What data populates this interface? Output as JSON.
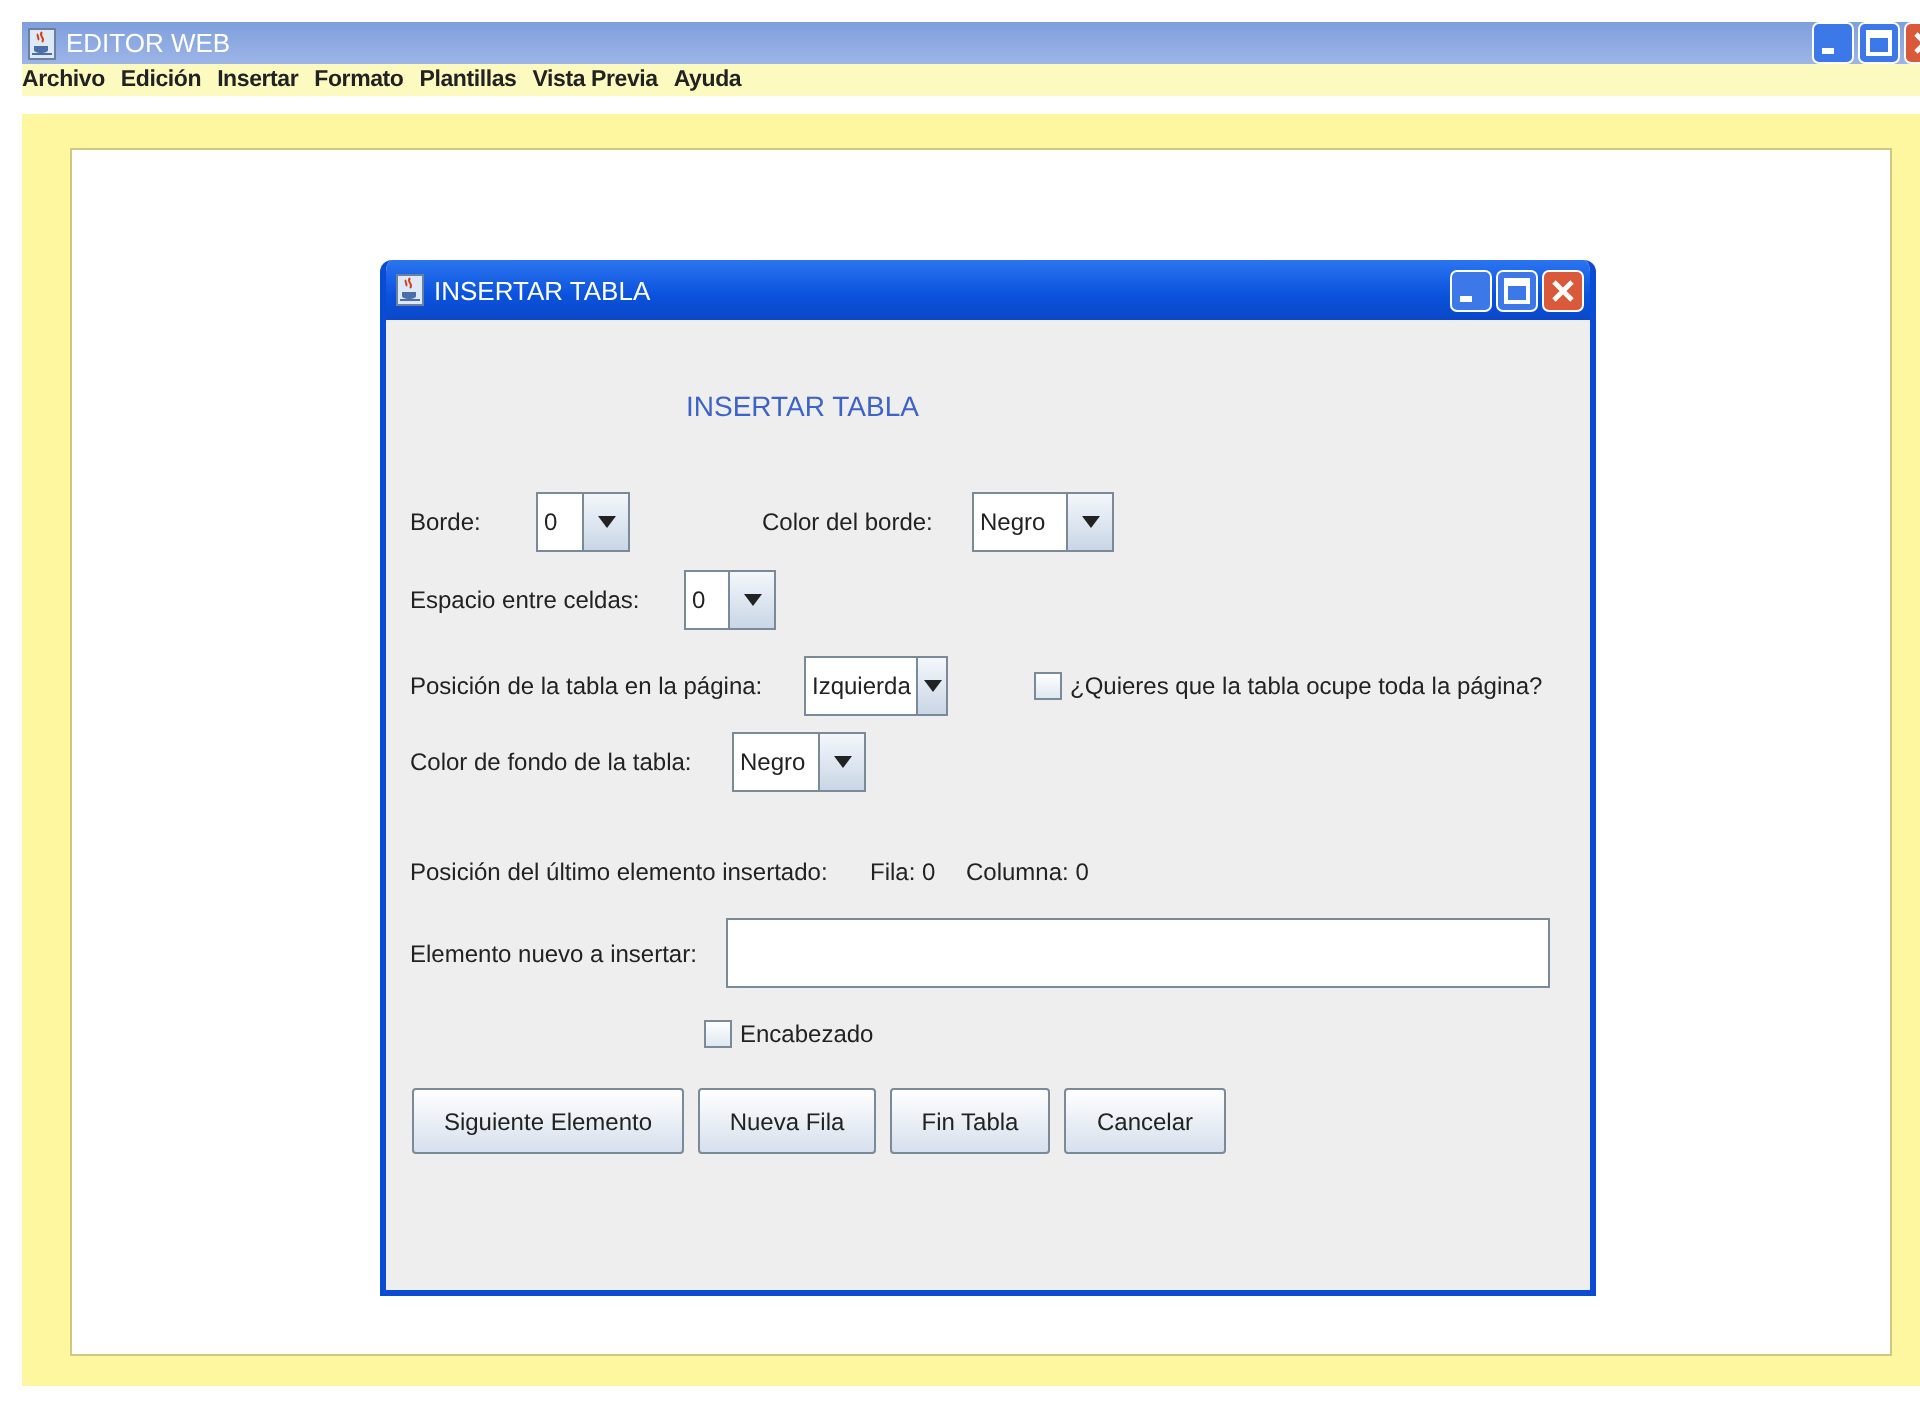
{
  "window": {
    "title": "EDITOR WEB"
  },
  "menu": [
    "Archivo",
    "Edición",
    "Insertar",
    "Formato",
    "Plantillas",
    "Vista Previa",
    "Ayuda"
  ],
  "dialog": {
    "title": "INSERTAR TABLA",
    "heading": "INSERTAR TABLA",
    "rows": [
      {
        "items": [
          {
            "kind": "label",
            "text": "Borde:"
          },
          {
            "kind": "combo",
            "value": "0"
          },
          {
            "kind": "label",
            "text": "Color del borde:"
          },
          {
            "kind": "combo",
            "value": "Negro"
          }
        ]
      },
      {
        "items": [
          {
            "kind": "label",
            "text": "Espacio entre celdas:"
          },
          {
            "kind": "combo",
            "value": "0"
          }
        ]
      },
      {
        "items": [
          {
            "kind": "label",
            "text": "Posición de la tabla en la página:"
          },
          {
            "kind": "combo",
            "value": "Izquierda"
          },
          {
            "kind": "checkbox",
            "text": "¿Quieres que la tabla ocupe toda la página?",
            "checked": false
          }
        ]
      },
      {
        "items": [
          {
            "kind": "label",
            "text": "Color de fondo de la tabla:"
          },
          {
            "kind": "combo",
            "value": "Negro"
          }
        ]
      },
      {
        "items": [
          {
            "kind": "label",
            "text": "Posición del último elemento insertado:"
          },
          {
            "kind": "label",
            "text": "Fila: 0"
          },
          {
            "kind": "label",
            "text": "Columna: 0"
          }
        ]
      },
      {
        "items": [
          {
            "kind": "label",
            "text": "Elemento nuevo a insertar:"
          },
          {
            "kind": "field",
            "value": ""
          }
        ]
      },
      {
        "items": [
          {
            "kind": "checkbox",
            "text": "Encabezado",
            "checked": false
          }
        ]
      }
    ],
    "buttons": [
      "Siguiente Elemento",
      "Nueva Fila",
      "Fin Tabla",
      "Cancelar"
    ]
  }
}
